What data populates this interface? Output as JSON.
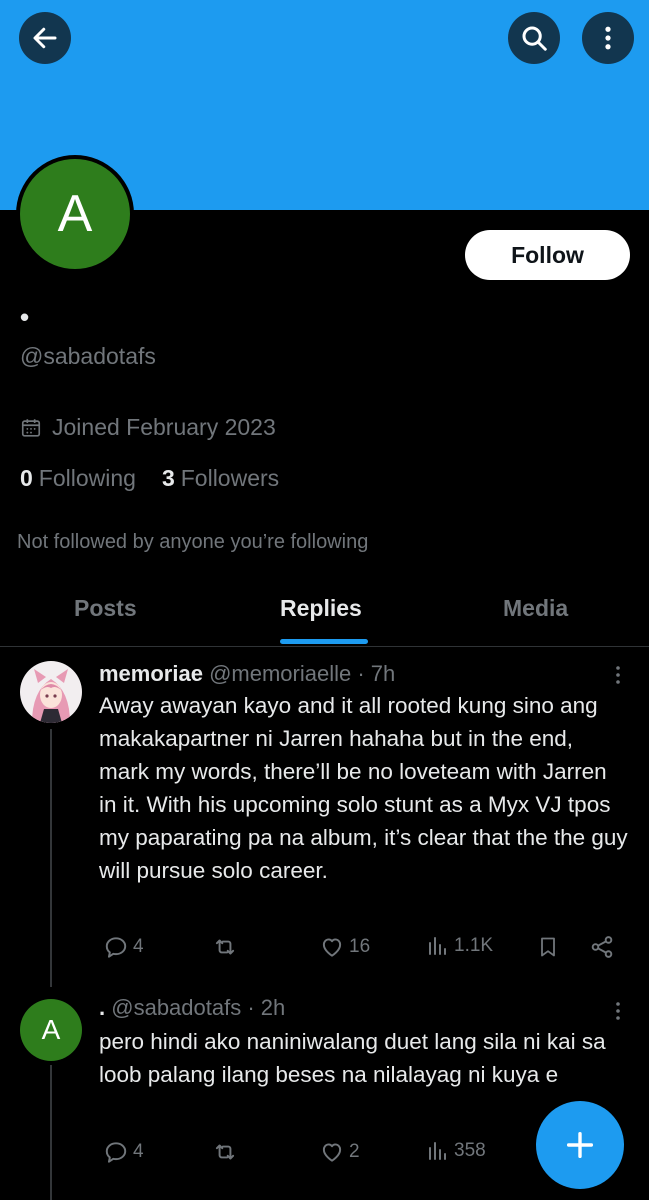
{
  "profile": {
    "avatar_letter": "A",
    "display_name": "•",
    "handle": "@sabadotafs",
    "joined": "Joined February 2023",
    "following_count": "0",
    "following_label": "Following",
    "followers_count": "3",
    "followers_label": "Followers",
    "not_followed_text": "Not followed by anyone you’re following",
    "follow_button": "Follow"
  },
  "tabs": [
    {
      "label": "Posts",
      "active": false
    },
    {
      "label": "Replies",
      "active": true
    },
    {
      "label": "Media",
      "active": false
    }
  ],
  "posts": [
    {
      "author_name": "memoriae",
      "author_handle": "@memoriaelle",
      "time": "· 7h",
      "text": "Away awayan kayo and it all rooted kung sino ang makakapartner ni Jarren hahaha but in the end, mark my words, there’ll be no loveteam with Jarren in it. With his upcoming solo stunt as a Myx VJ tpos my paparating pa na album, it’s clear that the the guy will pursue solo career.",
      "replies": "4",
      "reposts": "",
      "likes": "16",
      "views": "1.1K"
    },
    {
      "author_name": ".",
      "author_handle": "@sabadotafs",
      "time": "· 2h",
      "avatar_letter": "A",
      "text": "pero hindi ako naniniwalang duet lang sila ni kai sa loob palang ilang beses na nilalayag ni kuya e",
      "replies": "4",
      "reposts": "",
      "likes": "2",
      "views": "358"
    }
  ],
  "colors": {
    "accent": "#1d9bf0",
    "avatar_green": "#2e7d1c",
    "muted": "#71767b"
  }
}
